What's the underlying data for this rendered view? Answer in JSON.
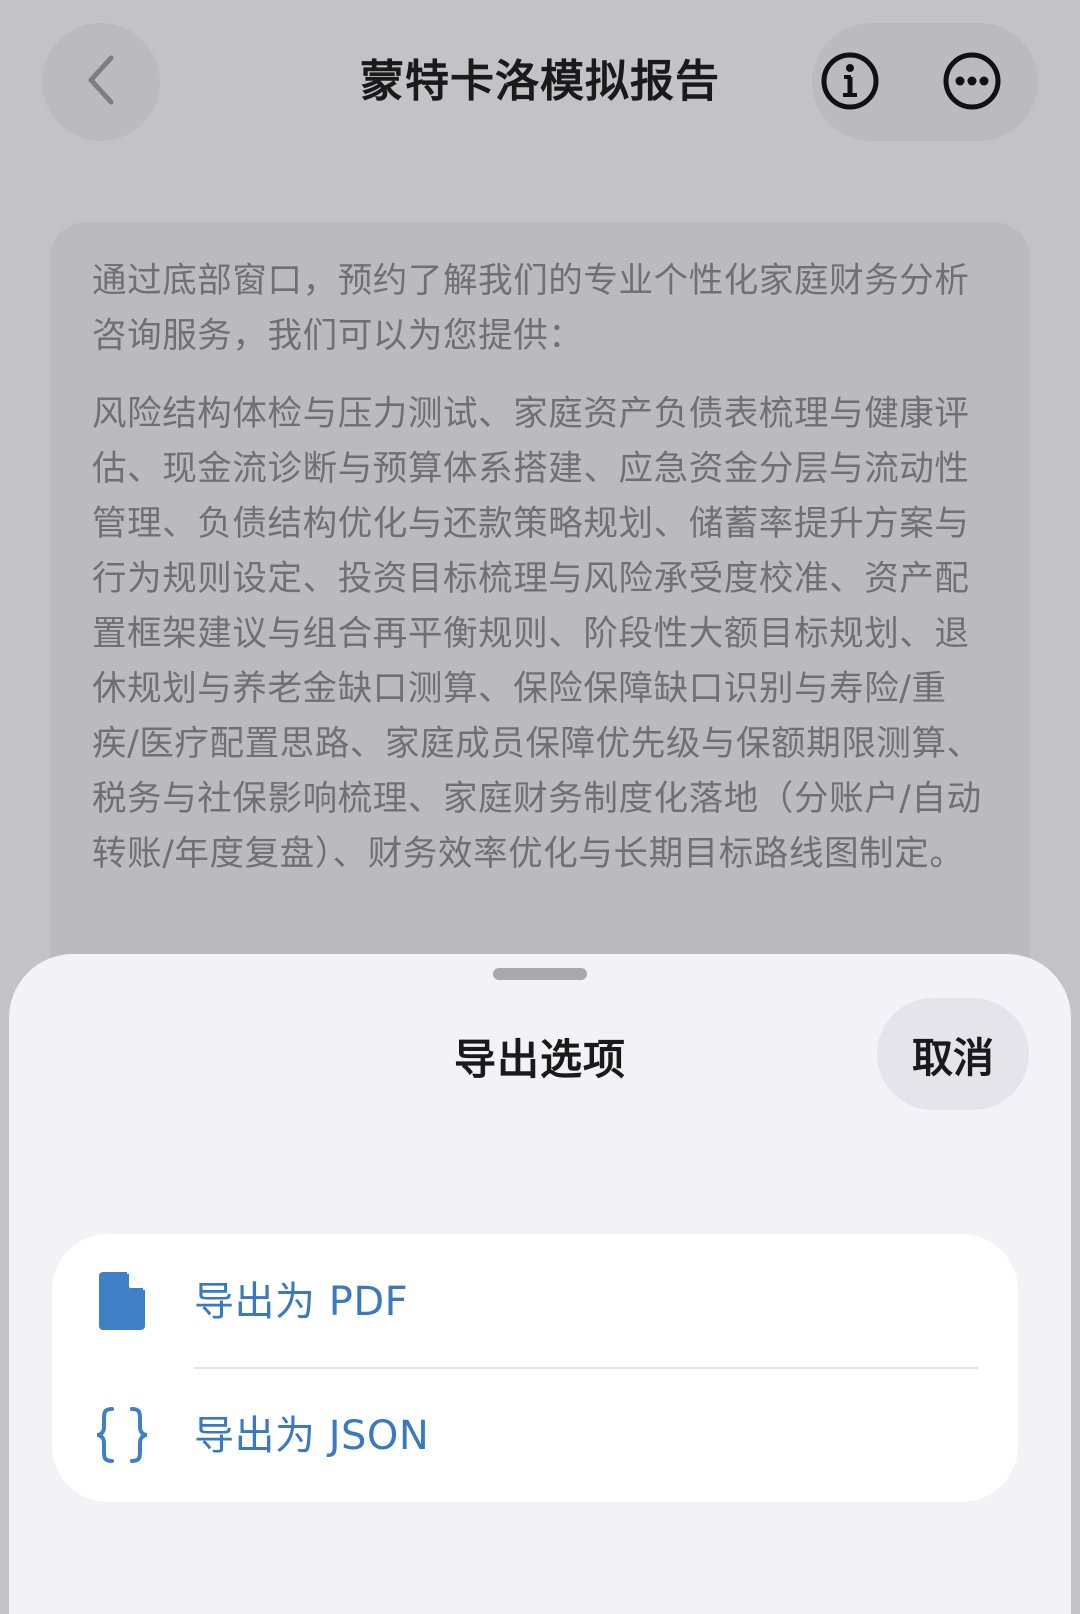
{
  "nav": {
    "title": "蒙特卡洛模拟报告"
  },
  "card": {
    "intro": "通过底部窗口，预约了解我们的专业个性化家庭财务分析咨询服务，我们可以为您提供：",
    "body": "风险结构体检与压力测试、家庭资产负债表梳理与健康评估、现金流诊断与预算体系搭建、应急资金分层与流动性管理、负债结构优化与还款策略规划、储蓄率提升方案与行为规则设定、投资目标梳理与风险承受度校准、资产配置框架建议与组合再平衡规则、阶段性大额目标规划、退休规划与养老金缺口测算、保险保障缺口识别与寿险/重疾/医疗配置思路、家庭成员保障优先级与保额期限测算、税务与社保影响梳理、家庭财务制度化落地（分账户/自动转账/年度复盘）、财务效率优化与长期目标路线图制定。"
  },
  "sheet": {
    "title": "导出选项",
    "cancel_label": "取消",
    "options": [
      {
        "label": "导出为 PDF",
        "icon": "document-icon"
      },
      {
        "label": "导出为 JSON",
        "icon": "curly-braces-icon"
      }
    ]
  },
  "colors": {
    "dim_background": "#c3c3c7",
    "sheet_background": "#f2f2f7",
    "accent": "#3a78c0",
    "icon_fill": "#3f7fc6"
  }
}
